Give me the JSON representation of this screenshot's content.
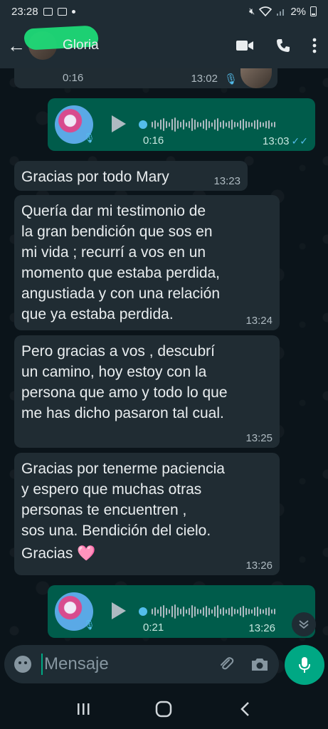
{
  "status_bar": {
    "time": "23:28",
    "battery": "2%"
  },
  "header": {
    "contact_name": "Gloria"
  },
  "messages": [
    {
      "type": "voice",
      "direction": "in",
      "duration": "0:16",
      "time": "13:02"
    },
    {
      "type": "voice",
      "direction": "out",
      "duration": "0:16",
      "time": "13:03"
    },
    {
      "type": "text",
      "direction": "in",
      "lines": [
        "Gracias por todo Mary"
      ],
      "time": "13:23"
    },
    {
      "type": "text",
      "direction": "in",
      "lines": [
        "Quería dar mi testimonio de",
        "la gran bendición que sos en",
        "mi vida ; recurrí a vos en un",
        "momento que estaba perdida,",
        "angustiada y con una relación",
        "que ya estaba perdida."
      ],
      "time": "13:24"
    },
    {
      "type": "text",
      "direction": "in",
      "lines": [
        "Pero gracias a vos , descubrí",
        "un camino, hoy estoy con la",
        "persona que amo y todo lo que",
        "me has dicho pasaron tal cual."
      ],
      "time": "13:25"
    },
    {
      "type": "text",
      "direction": "in",
      "lines": [
        "Gracias por tenerme paciencia",
        "y espero que muchas otras",
        "personas te encuentren ,",
        "sos una. Bendición del cielo.",
        "Gracias 🩷"
      ],
      "time": "13:26"
    },
    {
      "type": "voice",
      "direction": "out",
      "duration": "0:21",
      "time": "13:26"
    }
  ],
  "composer": {
    "placeholder": "Mensaje"
  },
  "icons": {
    "back": "arrow-left-icon",
    "video": "video-camera-icon",
    "call": "phone-icon",
    "menu": "more-vert-icon",
    "emoji": "emoji-icon",
    "attach": "paperclip-icon",
    "camera": "camera-icon",
    "mic": "microphone-icon"
  },
  "colors": {
    "accent": "#00a884",
    "outgoing": "#005c4b",
    "incoming": "#202c33",
    "read_ticks": "#53bdeb"
  }
}
